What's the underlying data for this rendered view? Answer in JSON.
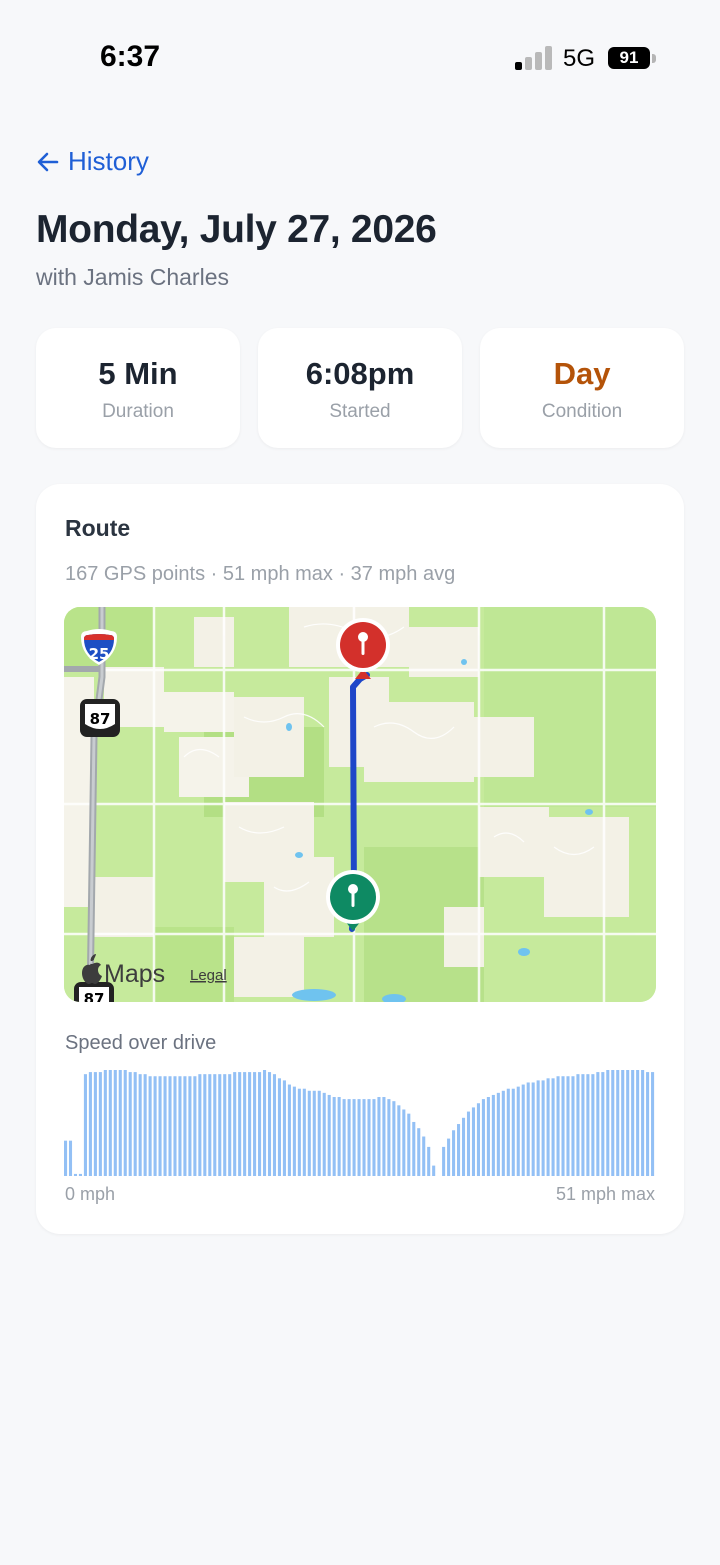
{
  "status_bar": {
    "time": "6:37",
    "network": "5G",
    "battery": "91"
  },
  "header": {
    "back_label": "History",
    "title": "Monday, July 27, 2026",
    "subtitle": "with Jamis Charles"
  },
  "stats": [
    {
      "value": "5 Min",
      "label": "Duration",
      "color": "#1c2430"
    },
    {
      "value": "6:08pm",
      "label": "Started",
      "color": "#1c2430"
    },
    {
      "value": "Day",
      "label": "Condition",
      "color": "#b45309"
    }
  ],
  "route": {
    "title": "Route",
    "meta": "167 GPS points · 51 mph max · 37 mph avg",
    "map": {
      "attribution": "Maps",
      "legal": "Legal",
      "shields": [
        "25",
        "87",
        "87"
      ],
      "route_color": "#1e46c8",
      "start_pin_color": "#0e8a63",
      "end_pin_color": "#d3302b"
    },
    "speed_label": "Speed over drive",
    "axis_min": "0 mph",
    "axis_max": "51 mph max"
  },
  "chart_data": {
    "type": "bar",
    "title": "Speed over drive",
    "xlabel": "",
    "ylabel": "",
    "ylim": [
      0,
      51
    ],
    "color": "#93c0f5",
    "values": [
      17,
      17,
      1,
      1,
      49,
      50,
      50,
      50,
      51,
      51,
      51,
      51,
      51,
      50,
      50,
      49,
      49,
      48,
      48,
      48,
      48,
      48,
      48,
      48,
      48,
      48,
      48,
      49,
      49,
      49,
      49,
      49,
      49,
      49,
      50,
      50,
      50,
      50,
      50,
      50,
      51,
      50,
      49,
      47,
      46,
      44,
      43,
      42,
      42,
      41,
      41,
      41,
      40,
      39,
      38,
      38,
      37,
      37,
      37,
      37,
      37,
      37,
      37,
      38,
      38,
      37,
      36,
      34,
      32,
      30,
      26,
      23,
      19,
      14,
      5,
      0,
      14,
      18,
      22,
      25,
      28,
      31,
      33,
      35,
      37,
      38,
      39,
      40,
      41,
      42,
      42,
      43,
      44,
      45,
      45,
      46,
      46,
      47,
      47,
      48,
      48,
      48,
      48,
      49,
      49,
      49,
      49,
      50,
      50,
      51,
      51,
      51,
      51,
      51,
      51,
      51,
      51,
      50,
      50
    ]
  }
}
